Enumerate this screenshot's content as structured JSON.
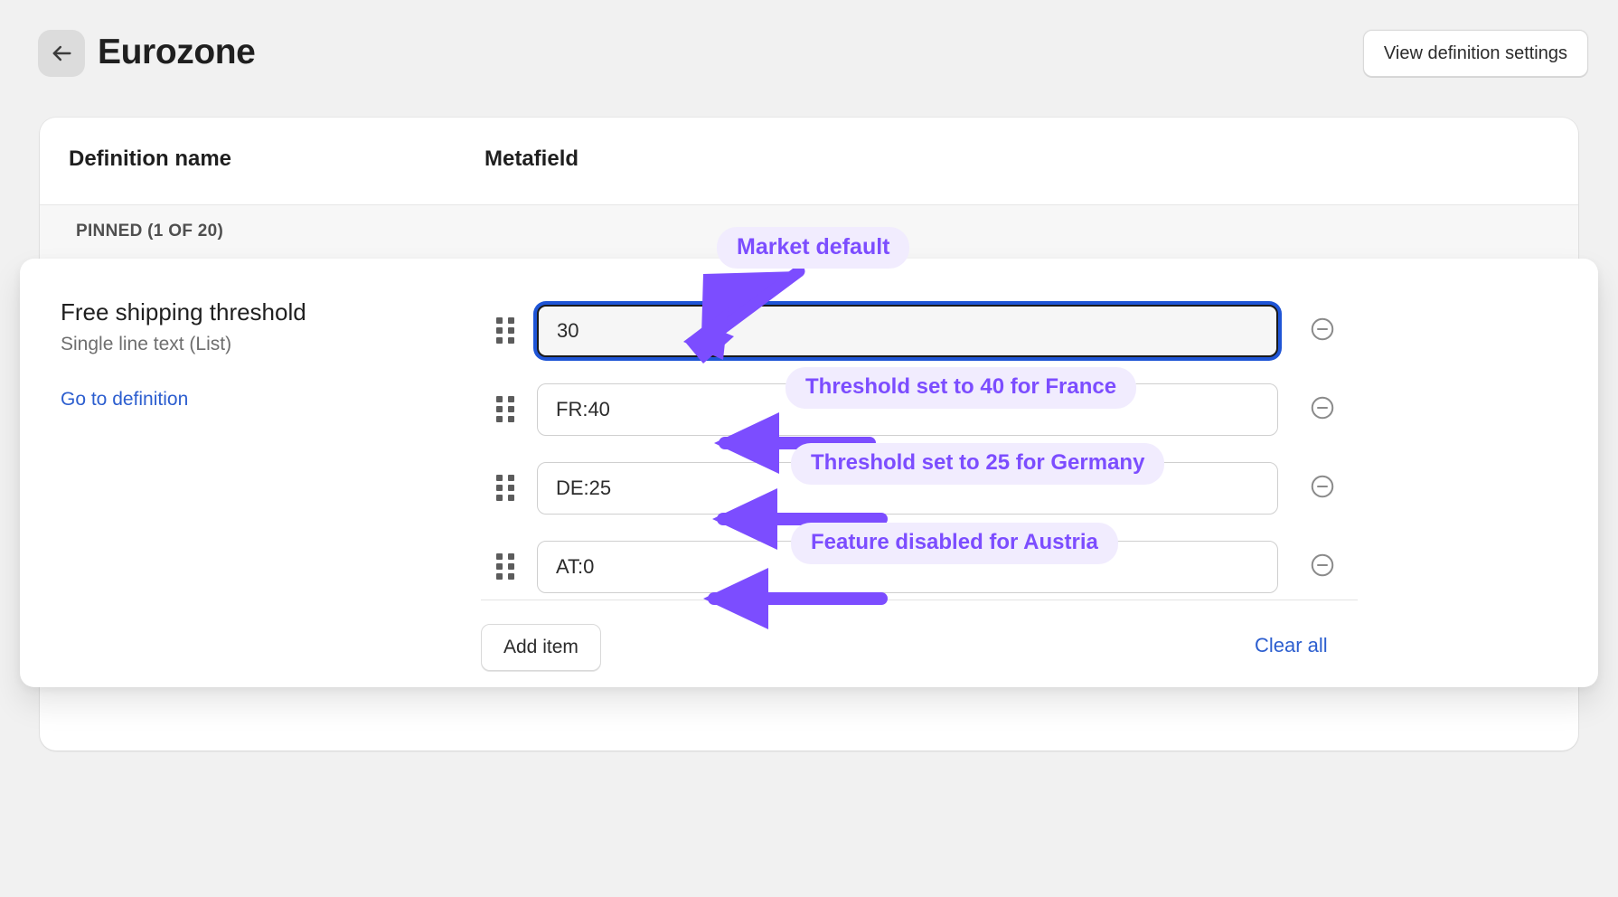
{
  "header": {
    "back_icon": "arrow-left-icon",
    "title": "Eurozone",
    "view_definition_settings": "View definition settings"
  },
  "table": {
    "columns": [
      "Definition name",
      "Metafield"
    ],
    "group_label": "PINNED (1 OF 20)"
  },
  "definition": {
    "name": "Free shipping threshold",
    "type": "Single line text (List)",
    "go_to_definition": "Go to definition"
  },
  "values": [
    {
      "value": "30",
      "handle_icon": "drag-handle-icon",
      "remove_icon": "minus-circle-icon",
      "focused": true
    },
    {
      "value": "FR:40",
      "handle_icon": "drag-handle-icon",
      "remove_icon": "minus-circle-icon",
      "focused": false
    },
    {
      "value": "DE:25",
      "handle_icon": "drag-handle-icon",
      "remove_icon": "minus-circle-icon",
      "focused": false
    },
    {
      "value": "AT:0",
      "handle_icon": "drag-handle-icon",
      "remove_icon": "minus-circle-icon",
      "focused": false
    }
  ],
  "footer": {
    "add_item": "Add item",
    "clear_all": "Clear all"
  },
  "annotations": [
    {
      "text": "Market default"
    },
    {
      "text": "Threshold set to 40 for France"
    },
    {
      "text": "Threshold set to 25 for Germany"
    },
    {
      "text": "Feature disabled for Austria"
    }
  ],
  "colors": {
    "annotation_text": "#7c4dff",
    "annotation_bg": "#f1ecfe",
    "arrow": "#7c4dff",
    "link": "#2c5ecf",
    "focus_ring": "#1f55d6",
    "page_bg": "#f1f1f1"
  }
}
